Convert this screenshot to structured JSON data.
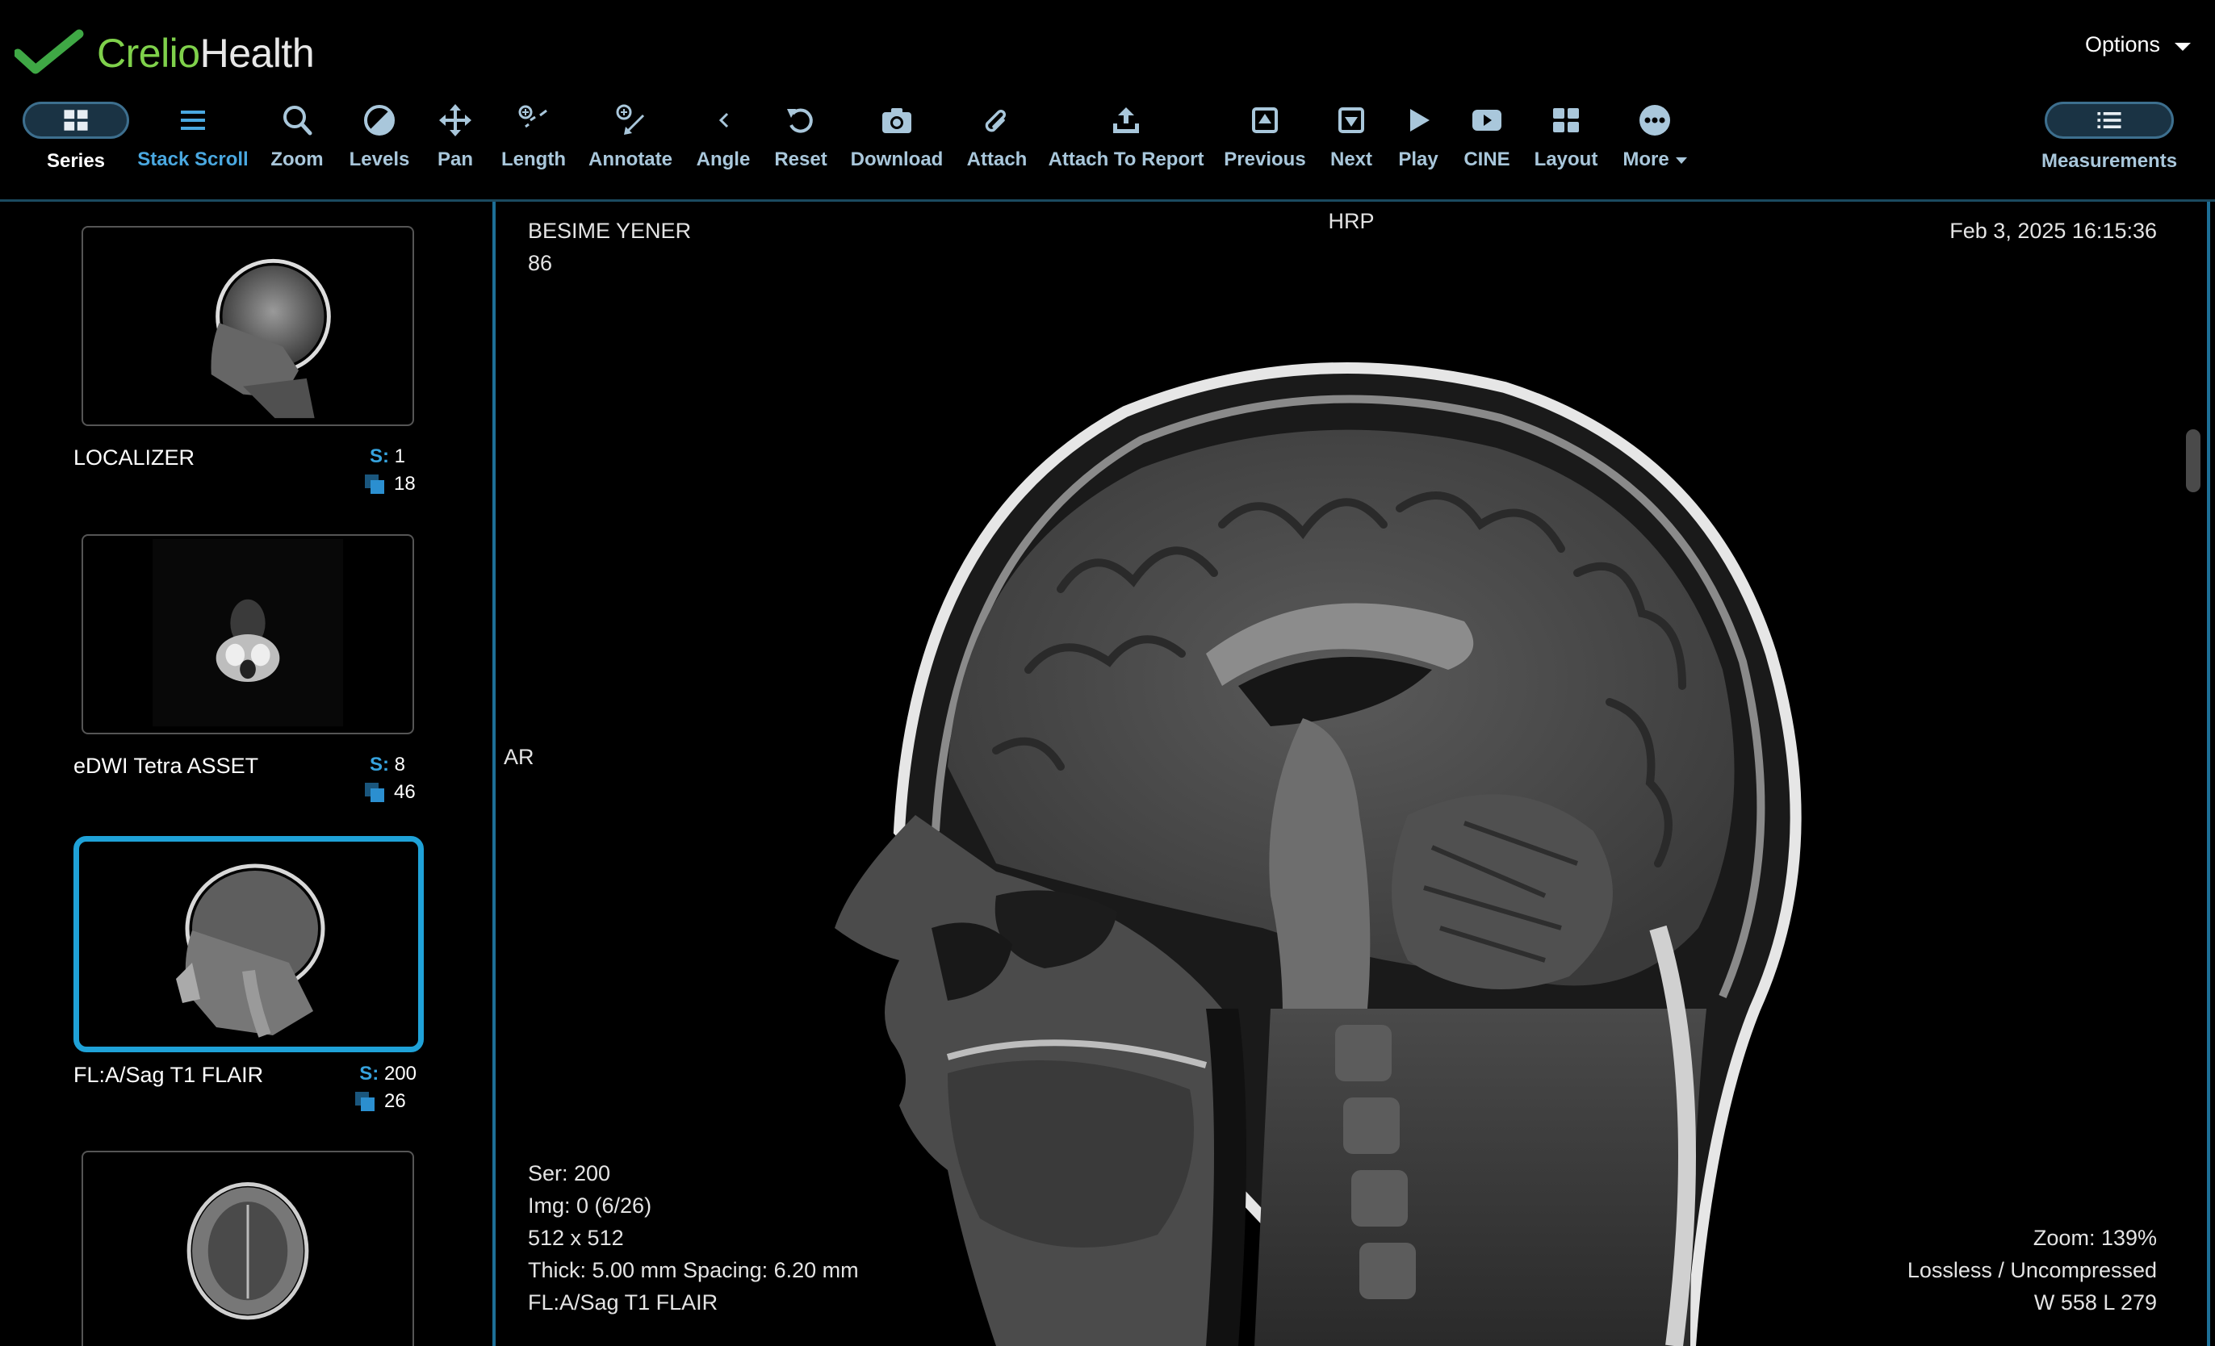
{
  "app": {
    "brand_part1": "Crelio",
    "brand_part2": "Health",
    "options_label": "Options",
    "accent": "#1fa2d8",
    "brand_green": "#7fd14b"
  },
  "toolbar": {
    "series": "Series",
    "stack_scroll": "Stack Scroll",
    "zoom": "Zoom",
    "levels": "Levels",
    "pan": "Pan",
    "length": "Length",
    "annotate": "Annotate",
    "angle": "Angle",
    "reset": "Reset",
    "download": "Download",
    "attach": "Attach",
    "attach_to_report": "Attach To Report",
    "previous": "Previous",
    "next": "Next",
    "play": "Play",
    "cine": "CINE",
    "layout": "Layout",
    "more": "More",
    "measurements": "Measurements",
    "active_tool": "stack_scroll"
  },
  "series_list": [
    {
      "label": "LOCALIZER",
      "s_prefix": "S:",
      "series_no": "1",
      "images": "18",
      "selected": false
    },
    {
      "label": "eDWI Tetra ASSET",
      "s_prefix": "S:",
      "series_no": "8",
      "images": "46",
      "selected": false
    },
    {
      "label": "FL:A/Sag T1 FLAIR",
      "s_prefix": "S:",
      "series_no": "200",
      "images": "26",
      "selected": true
    },
    {
      "label": "",
      "s_prefix": "",
      "series_no": "",
      "images": "",
      "selected": false
    }
  ],
  "viewport": {
    "patient_name": "BESIME YENER",
    "patient_age": "86",
    "orientation_top": "HRP",
    "orientation_left": "AR",
    "datetime": "Feb 3, 2025 16:15:36",
    "ser": "Ser: 200",
    "img": "Img: 0 (6/26)",
    "matrix": "512 x 512",
    "thickness": "Thick: 5.00 mm Spacing: 6.20 mm",
    "series_desc": "FL:A/Sag T1 FLAIR",
    "zoom": "Zoom: 139%",
    "compression": "Lossless / Uncompressed",
    "window_level": "W 558 L 279"
  }
}
